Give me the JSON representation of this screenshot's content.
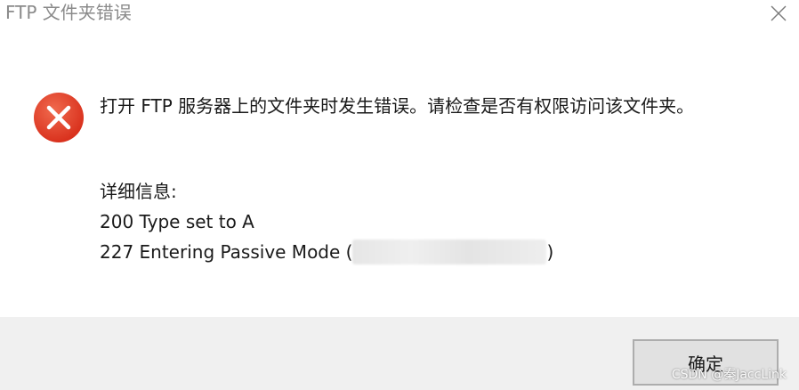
{
  "window": {
    "title": "FTP 文件夹错误",
    "close_icon": "close-icon"
  },
  "message": {
    "icon": "error-icon",
    "text": "打开 FTP 服务器上的文件夹时发生错误。请检查是否有权限访问该文件夹。"
  },
  "details": {
    "heading": "详细信息:",
    "line1": "200 Type set to A",
    "line2_prefix": "227 Entering Passive Mode (",
    "line2_suffix": ")"
  },
  "footer": {
    "ok_label": "确定"
  },
  "watermark": "CSDN @秦JaccLink",
  "colors": {
    "error_red": "#e8402a",
    "footer_bg": "#f0f0f0",
    "button_bg": "#e1e1e1",
    "button_border": "#adadad"
  }
}
